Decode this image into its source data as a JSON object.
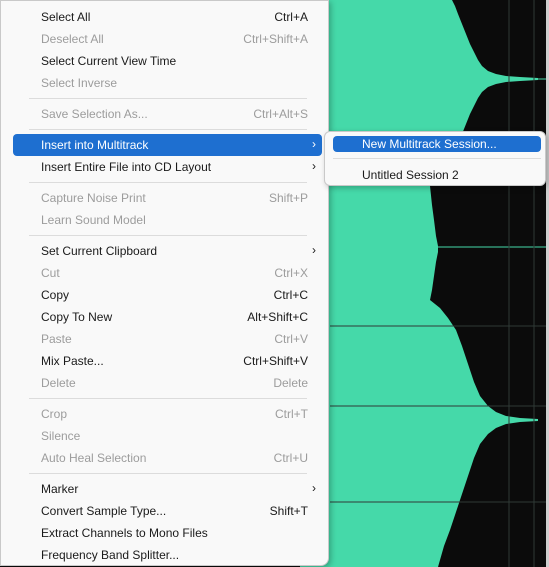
{
  "colors": {
    "waveform": "#45d9a9",
    "background": "#0b0b0b",
    "highlight": "#1e6fd0"
  },
  "context_menu": {
    "items": [
      {
        "label": "Select All",
        "shortcut": "Ctrl+A"
      },
      {
        "label": "Deselect All",
        "shortcut": "Ctrl+Shift+A"
      },
      {
        "label": "Select Current View Time",
        "shortcut": ""
      },
      {
        "label": "Select Inverse",
        "shortcut": ""
      },
      {
        "label": "Save Selection As...",
        "shortcut": "Ctrl+Alt+S"
      },
      {
        "label": "Insert into Multitrack",
        "shortcut": ""
      },
      {
        "label": "Insert Entire File into CD Layout",
        "shortcut": ""
      },
      {
        "label": "Capture Noise Print",
        "shortcut": "Shift+P"
      },
      {
        "label": "Learn Sound Model",
        "shortcut": ""
      },
      {
        "label": "Set Current Clipboard",
        "shortcut": ""
      },
      {
        "label": "Cut",
        "shortcut": "Ctrl+X"
      },
      {
        "label": "Copy",
        "shortcut": "Ctrl+C"
      },
      {
        "label": "Copy To New",
        "shortcut": "Alt+Shift+C"
      },
      {
        "label": "Paste",
        "shortcut": "Ctrl+V"
      },
      {
        "label": "Mix Paste...",
        "shortcut": "Ctrl+Shift+V"
      },
      {
        "label": "Delete",
        "shortcut": "Delete"
      },
      {
        "label": "Crop",
        "shortcut": "Ctrl+T"
      },
      {
        "label": "Silence",
        "shortcut": ""
      },
      {
        "label": "Auto Heal Selection",
        "shortcut": "Ctrl+U"
      },
      {
        "label": "Marker",
        "shortcut": ""
      },
      {
        "label": "Convert Sample Type...",
        "shortcut": "Shift+T"
      },
      {
        "label": "Extract Channels to Mono Files",
        "shortcut": ""
      },
      {
        "label": "Frequency Band Splitter...",
        "shortcut": ""
      }
    ],
    "submenu_arrow": "›"
  },
  "submenu": {
    "items": [
      {
        "label": "New Multitrack Session..."
      },
      {
        "label": "Untitled Session 2"
      }
    ]
  }
}
